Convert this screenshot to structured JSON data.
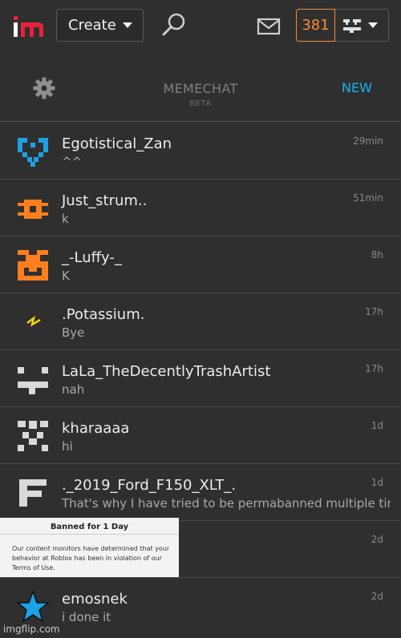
{
  "topbar": {
    "create_label": "Create",
    "notification_count": "381"
  },
  "chat_header": {
    "title": "MEMECHAT",
    "subtitle": "BETA",
    "new_label": "NEW"
  },
  "colors": {
    "accent_orange": "#ff8c2e",
    "link_blue": "#19b5f0",
    "logo_red": "#e8213b"
  },
  "conversations": [
    {
      "name": "Egotistical_Zan",
      "message": "^^",
      "time": "29min",
      "avatar_icon": "heart-pixel-avatar-icon",
      "avatar_color": "#1ba3e6"
    },
    {
      "name": "Just_strum..",
      "message": "k",
      "time": "51min",
      "avatar_icon": "orange-pixel-avatar-icon",
      "avatar_color": "#ff7f1e"
    },
    {
      "name": "_-Luffy-_",
      "message": "K",
      "time": "8h",
      "avatar_icon": "orange-face-avatar-icon",
      "avatar_color": "#ff7f1e"
    },
    {
      "name": ".Potassium.",
      "message": "Bye",
      "time": "17h",
      "avatar_icon": "lightning-avatar-icon",
      "avatar_color": "#f5d311"
    },
    {
      "name": "LaLa_TheDecentlyTrashArtist",
      "message": "nah",
      "time": "17h",
      "avatar_icon": "gray-pixel-avatar-icon",
      "avatar_color": "#d9d9d9"
    },
    {
      "name": "kharaaaa",
      "message": "hi",
      "time": "1d",
      "avatar_icon": "gray-face-avatar-icon",
      "avatar_color": "#d9d9d9"
    },
    {
      "name": "._2019_Ford_F150_XLT_.",
      "message": "That's why I have tried to be permabanned multiple tim",
      "time": "1d",
      "avatar_icon": "letter-f-avatar-icon",
      "avatar_color": "#d9d9d9"
    },
    {
      "name": "",
      "message": "",
      "time": "2d",
      "avatar_icon": "",
      "avatar_color": ""
    },
    {
      "name": "emosnek",
      "message": "i done it",
      "time": "2d",
      "avatar_icon": "blue-star-avatar-icon",
      "avatar_color": "#1ba3e6"
    }
  ],
  "banned_image": {
    "title": "Banned for 1 Day",
    "body": "Our content monitors have determined that your behavior at Roblox has been in violation of our Terms of Use."
  },
  "watermark": "imgflip.com"
}
